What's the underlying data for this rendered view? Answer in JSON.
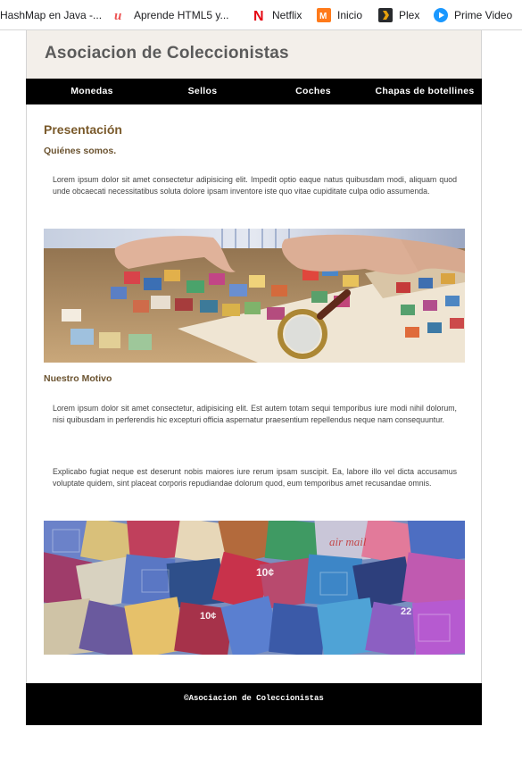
{
  "bookmarks": [
    {
      "label": "HashMap en Java -...",
      "icon": "generic-page-icon"
    },
    {
      "label": "Aprende HTML5 y...",
      "icon": "udemy-icon",
      "color": "#ec5252"
    },
    {
      "label": "Netflix",
      "icon": "netflix-icon",
      "color": "#e50914"
    },
    {
      "label": "Inicio",
      "icon": "inicio-icon",
      "color": "#ff7a1a"
    },
    {
      "label": "Plex",
      "icon": "plex-icon",
      "color": "#e5a00d"
    },
    {
      "label": "Prime Video",
      "icon": "prime-video-icon",
      "color": "#1a98ff"
    }
  ],
  "site": {
    "title": "Asociacion de Coleccionistas",
    "nav": [
      "Monedas",
      "Sellos",
      "Coches",
      "Chapas de botellines"
    ]
  },
  "main": {
    "heading": "Presentación",
    "section1_title": "Quiénes somos.",
    "section1_text": "Lorem ipsum dolor sit amet consectetur adipisicing elit. Impedit optio eaque natus quibusdam modi, aliquam quod unde obcaecati necessitatibus soluta dolore ipsam inventore iste quo vitae cupiditate culpa odio assumenda.",
    "section2_title": "Nuestro Motivo",
    "section2_text1": "Lorem ipsum dolor sit amet consectetur, adipisicing elit. Est autem totam sequi temporibus iure modi nihil dolorum, nisi quibusdam in perferendis hic excepturi officia aspernatur praesentium repellendus neque nam consequuntur.",
    "section2_text2": "Explicabo fugiat neque est deserunt nobis maiores iure rerum ipsam suscipit. Ea, labore illo vel dicta accusamus voluptate quidem, sint placeat corporis repudiandae dolorum quod, eum temporibus amet recusandae omnis."
  },
  "footer": {
    "text": "©Asociacion de Coleccionistas"
  },
  "colors": {
    "header_bg": "#f3efea",
    "nav_bg": "#000000",
    "heading": "#7a5a2b",
    "title": "#5b5b5b"
  }
}
